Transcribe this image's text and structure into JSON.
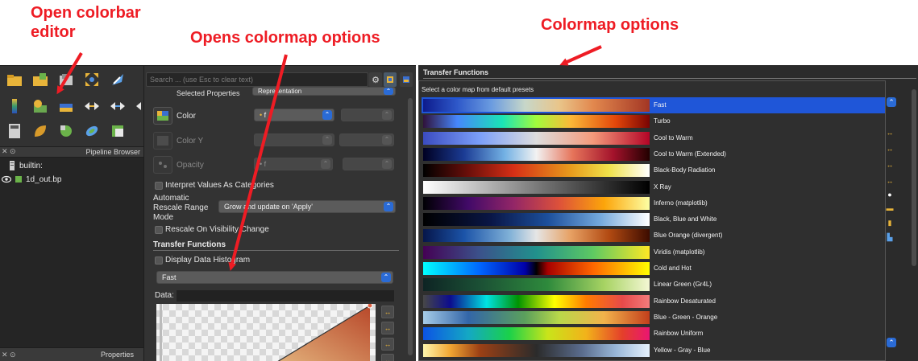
{
  "annotations": {
    "colorbar_editor": "Open colorbar\neditor",
    "colormap_options_opener": "Opens colormap options",
    "colormap_options": "Colormap options"
  },
  "colors": {
    "annotation": "#ee1c24",
    "selection": "#1f56d8",
    "combo_arrow": "#2a6bd6",
    "panel_bg": "#2b2b2b"
  },
  "pipeline_browser": {
    "title": "Pipeline Browser",
    "items": [
      {
        "label": "builtin:",
        "icon": "server-icon"
      },
      {
        "label": "1d_out.bp",
        "icon": "eye-icon"
      }
    ]
  },
  "properties_dock": {
    "title": "Properties"
  },
  "properties": {
    "search_placeholder": "Search ... (use Esc to clear text)",
    "selected_properties_label": "Selected Properties",
    "selected_properties_value": "Representation",
    "color_label": "Color",
    "color_value": "f",
    "color_y_label": "Color Y",
    "opacity_label": "Opacity",
    "opacity_value": "f",
    "interpret_categories": "Interpret Values As Categories",
    "auto_rescale_label": "Automatic\nRescale Range\nMode",
    "auto_rescale_value": "Grow and update on 'Apply'",
    "rescale_visibility": "Rescale On Visibility Change",
    "transfer_functions_title": "Transfer Functions",
    "display_histogram": "Display Data Histogram",
    "colormap_selected": "Fast",
    "data_label": "Data:"
  },
  "dialog": {
    "title": "Transfer Functions",
    "hint": "Select a color map from default presets",
    "selected_index": 0,
    "presets": [
      {
        "name": "Fast",
        "gradient": "linear-gradient(90deg,#0d1b8c 0%,#2e58c9 15%,#6a9be0 30%,#c7d7c9 45%,#e9c58a 60%,#e2884e 75%,#a33624 100%)"
      },
      {
        "name": "Turbo",
        "gradient": "linear-gradient(90deg,#30123b 0%,#4686fb 15%,#1ae4b6 35%,#a2fc3c 50%,#fbb938 65%,#e4460a 85%,#7a0403 100%)"
      },
      {
        "name": "Cool to Warm",
        "gradient": "linear-gradient(90deg,#3b4cc0 0%,#7b9ff9 25%,#dddddd 50%,#f49a7b 75%,#b40426 100%)"
      },
      {
        "name": "Cool to Warm (Extended)",
        "gradient": "linear-gradient(90deg,#000022 0%,#1b3b94 18%,#73b1e4 36%,#f2f2f2 50%,#e6745a 66%,#a3122b 84%,#220000 100%)"
      },
      {
        "name": "Black-Body Radiation",
        "gradient": "linear-gradient(90deg,#000000 0%,#6b0f0a 20%,#d62f16 40%,#e89a1c 65%,#f0e24a 82%,#ffffff 100%)"
      },
      {
        "name": "X Ray",
        "gradient": "linear-gradient(90deg,#ffffff 0%,#7a7a7a 50%,#000000 100%)"
      },
      {
        "name": "Inferno (matplotlib)",
        "gradient": "linear-gradient(90deg,#000004 0%,#420a68 20%,#932667 40%,#dd513a 60%,#fca50a 80%,#fcffa4 100%)"
      },
      {
        "name": "Black, Blue and White",
        "gradient": "linear-gradient(90deg,#000000 0%,#0a1646 30%,#1c4f9c 55%,#73a8dc 78%,#ffffff 100%)"
      },
      {
        "name": "Blue Orange (divergent)",
        "gradient": "linear-gradient(90deg,#06164a 0%,#1b53a8 18%,#7fb0d7 38%,#e5e5e5 50%,#e7a164 65%,#b24a12 82%,#3d0c00 100%)"
      },
      {
        "name": "Viridis (matplotlib)",
        "gradient": "linear-gradient(90deg,#440154 0%,#3b528b 25%,#21918c 50%,#5ec962 75%,#fde725 100%)"
      },
      {
        "name": "Cold and Hot",
        "gradient": "linear-gradient(90deg,#00ffff 0%,#0066ff 25%,#0000a8 45%,#000000 50%,#a80000 55%,#ff6600 75%,#ffff00 100%)"
      },
      {
        "name": "Linear Green (Gr4L)",
        "gradient": "linear-gradient(90deg,#0e2424 0%,#1b5035 25%,#2e8a3c 55%,#a7d363 80%,#f4f7d4 100%)"
      },
      {
        "name": "Rainbow Desaturated",
        "gradient": "linear-gradient(90deg,#474747 0%,#0c0c8e 12%,#00e3e3 28%,#019301 42%,#ffff00 58%,#ff7b00 72%,#e64a4a 88%,#f37b7b 100%)"
      },
      {
        "name": "Blue - Green - Orange",
        "gradient": "linear-gradient(90deg,#a6cce8 0%,#3366a8 20%,#5ba05c 45%,#b9d84a 60%,#f2b24b 80%,#c33f1c 100%)"
      },
      {
        "name": "Rainbow Uniform",
        "gradient": "linear-gradient(90deg,#0c54e4 0%,#14a8c4 20%,#1ad14a 38%,#c9e41a 55%,#f2b21a 72%,#e43f2a 88%,#ea1572 100%)"
      },
      {
        "name": "Yellow - Gray - Blue",
        "gradient": "linear-gradient(90deg,#fdf5ac 0%,#f0a532 12%,#9b4015 25%,#2b2b2b 50%,#5a6c8d 70%,#99b7d8 85%,#e5f1fc 100%)"
      }
    ]
  }
}
